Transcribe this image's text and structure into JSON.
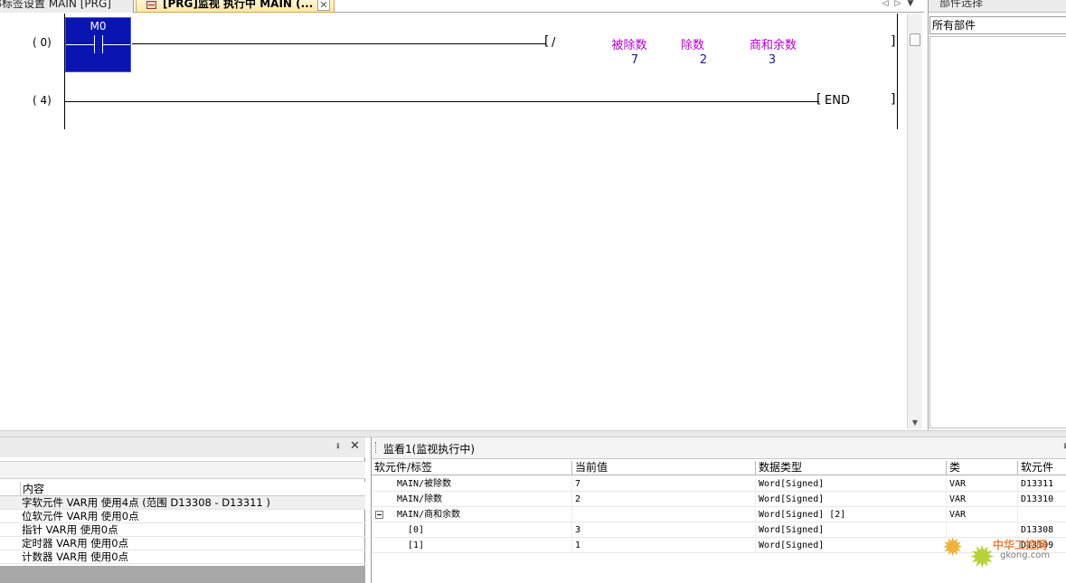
{
  "tabs": [
    {
      "label": "部标签设置 MAIN [PRG]"
    },
    {
      "label": "[PRG]监视 执行中 MAIN (..."
    }
  ],
  "tab_close": "✕",
  "nav": {
    "prev": "◁",
    "next": "▷",
    "menu": "▼"
  },
  "ladder": {
    "rungs": [
      {
        "step": "(    0)",
        "contact": "M0",
        "instruction": "/",
        "operands": [
          {
            "label": "被除数",
            "value": "7"
          },
          {
            "label": "除数",
            "value": "2"
          },
          {
            "label": "商和余数",
            "value": "3"
          }
        ]
      },
      {
        "step": "(    4)",
        "instruction": "END"
      }
    ],
    "bracket_left": "[",
    "bracket_right": "]"
  },
  "parts_panel": {
    "title": "部件选择",
    "selected": "所有部件"
  },
  "device_panel": {
    "pin": "ᵻ",
    "close": "✕",
    "header": "内容",
    "rows": [
      "字软元件 VAR用 使用4点 (范围 D13308 - D13311 )",
      "位软元件 VAR用 使用0点",
      "指针 VAR用 使用0点",
      "定时器 VAR用 使用0点",
      "计数器 VAR用 使用0点"
    ]
  },
  "watch_panel": {
    "title": "监看1(监视执行中)",
    "pin": "ᵻ",
    "columns": [
      "软元件/标签",
      "当前值",
      "数据类型",
      "类",
      "软元件"
    ],
    "rows": [
      {
        "name": "MAIN/被除数",
        "value": "7",
        "type": "Word[Signed]",
        "class": "VAR",
        "device": "D13311",
        "expander": false,
        "indent": 1
      },
      {
        "name": "MAIN/除数",
        "value": "2",
        "type": "Word[Signed]",
        "class": "VAR",
        "device": "D13310",
        "expander": false,
        "indent": 1
      },
      {
        "name": "MAIN/商和余数",
        "value": "",
        "type": "Word[Signed] [2]",
        "class": "VAR",
        "device": "",
        "expander": true,
        "indent": 1
      },
      {
        "name": "[0]",
        "value": "3",
        "type": "Word[Signed]",
        "class": "",
        "device": "D13308",
        "expander": false,
        "indent": 2
      },
      {
        "name": "[1]",
        "value": "1",
        "type": "Word[Signed]",
        "class": "",
        "device": "D13309",
        "expander": false,
        "indent": 2
      }
    ]
  },
  "watermark": {
    "text": "中华工控网",
    "url": "gkong.com"
  }
}
